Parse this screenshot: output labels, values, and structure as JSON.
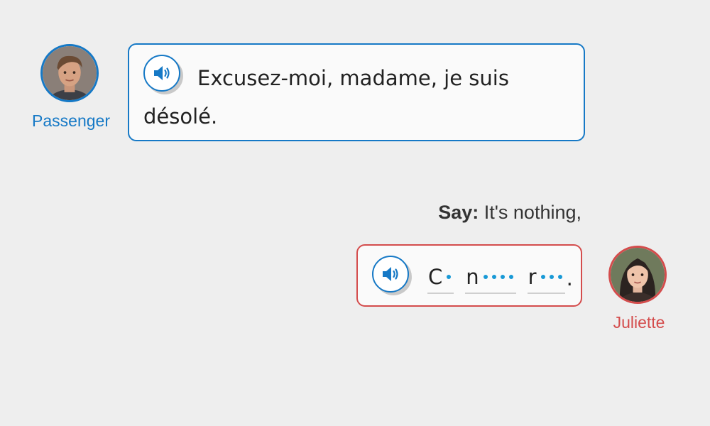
{
  "passenger": {
    "name": "Passenger",
    "line": "Excusez-moi, madame, je suis désolé.",
    "border_color": "#1679c6"
  },
  "prompt": {
    "label": "Say:",
    "text": "It's nothing,"
  },
  "juliette": {
    "name": "Juliette",
    "border_color": "#d44c4c",
    "answer": {
      "blanks": [
        {
          "hint": "C",
          "remaining": 1
        },
        {
          "hint": "n",
          "remaining": 4
        },
        {
          "hint": "r",
          "remaining": 3
        }
      ],
      "punctuation": "."
    }
  },
  "icons": {
    "audio": "speaker-icon",
    "placeholder": "dot-placeholder"
  },
  "accent_dot_color": "#1899d6"
}
